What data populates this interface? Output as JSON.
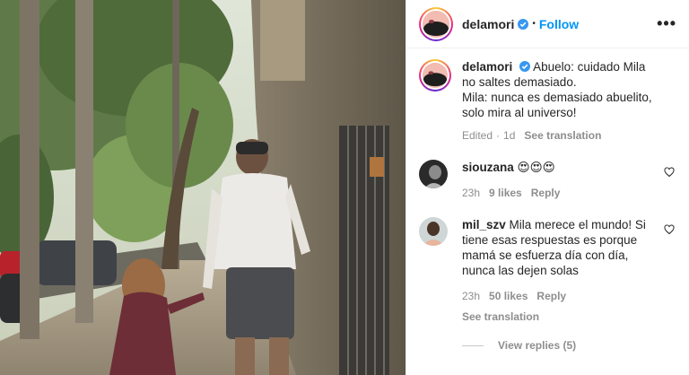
{
  "header": {
    "username": "delamori",
    "dot": "•",
    "follow_label": "Follow",
    "more_label": "•••"
  },
  "caption": {
    "username": "delamori",
    "text_line1": "Abuelo: cuidado Mila no saltes demasiado.",
    "text_line2": "Mila: nunca es demasiado abuelito, solo mira al universo!",
    "edited": "Edited",
    "dot": "·",
    "age": "1d",
    "see_translation": "See translation"
  },
  "comments": [
    {
      "username": "siouzana",
      "text": "😍😍😍",
      "age": "23h",
      "likes": "9 likes",
      "reply": "Reply"
    },
    {
      "username": "mil_szv",
      "text": "Mila merece el mundo! Si tiene esas respuestas es porque mamá se esfuerza día con día, nunca las dejen solas",
      "age": "23h",
      "likes": "50 likes",
      "reply": "Reply",
      "see_translation": "See translation"
    }
  ],
  "view_replies": "View replies (5)",
  "colors": {
    "accent": "#0095f6",
    "verified": "#3897f0",
    "muted": "#8e8e8e"
  },
  "icons": {
    "verified": "verified-badge-icon",
    "heart": "heart-outline-icon",
    "more": "more-options-icon"
  }
}
